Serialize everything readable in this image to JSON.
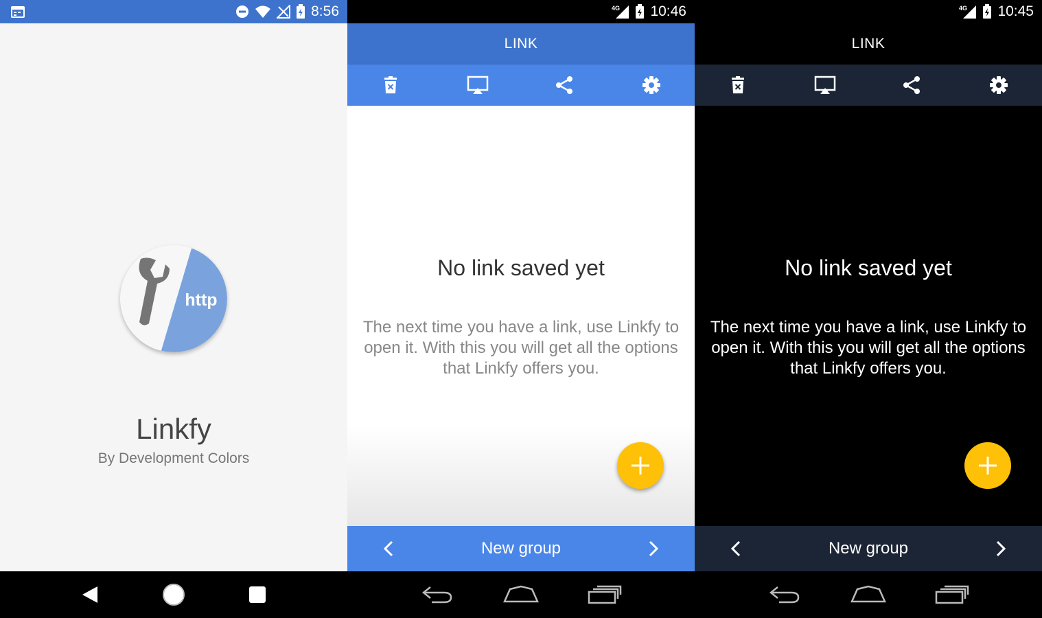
{
  "splash": {
    "status_time": "8:56",
    "logo_text": "http",
    "app_name": "Linkfy",
    "app_by": "By Development Colors"
  },
  "light": {
    "status_time": "10:46",
    "app_title": "LINK",
    "empty_title": "No link saved yet",
    "empty_desc": "The next time you have a link, use Linkfy to open it. With this you will get all the options that Linkfy offers you.",
    "group_label": "New group"
  },
  "dark": {
    "status_time": "10:45",
    "app_title": "LINK",
    "empty_title": "No link saved yet",
    "empty_desc": "The next time you have a link, use Linkfy to open it. With this you will get all the options that Linkfy offers you.",
    "group_label": "New group"
  },
  "icons": {
    "toolbar": [
      "delete-icon",
      "cast-icon",
      "share-icon",
      "settings-icon"
    ],
    "group_nav": [
      "chevron-left-icon",
      "chevron-right-icon"
    ],
    "system_nav": [
      "back-icon",
      "home-icon",
      "recents-icon"
    ]
  },
  "colors": {
    "primary_dark": "#3d73cc",
    "primary": "#4a86e8",
    "accent": "#ffc107",
    "dark_toolbar": "#1c2535",
    "logo_blue": "#7aa3de"
  }
}
